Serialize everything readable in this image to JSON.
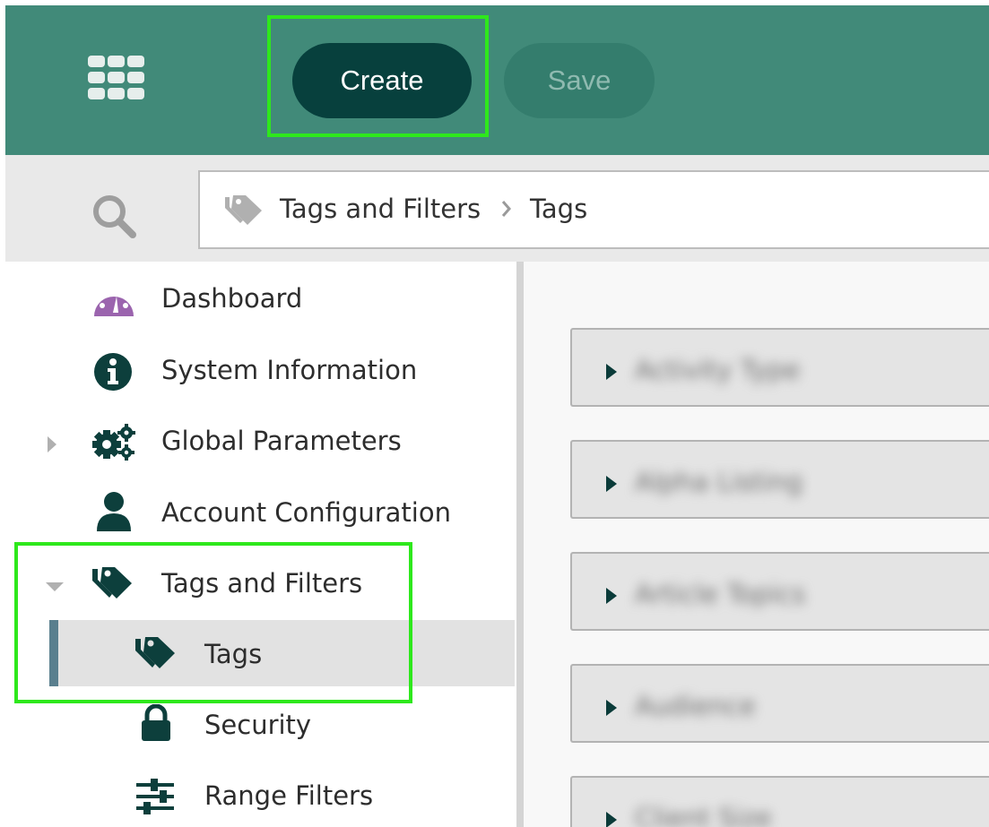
{
  "toolbar": {
    "apps_icon": "grid-apps-icon",
    "create_label": "Create",
    "save_label": "Save",
    "colors": {
      "bar": "#418a79",
      "create_bg": "#07403d",
      "save_bg": "#347d6d",
      "highlight": "#2ee81c"
    }
  },
  "search": {
    "icon": "search-icon"
  },
  "breadcrumb": {
    "icon": "tags-icon",
    "parent": "Tags and Filters",
    "separator_icon": "chevron-right-icon",
    "current": "Tags"
  },
  "sidebar": {
    "items": [
      {
        "label": "Dashboard",
        "icon": "dashboard-gauge-icon",
        "expandable": false
      },
      {
        "label": "System Information",
        "icon": "info-icon",
        "expandable": false
      },
      {
        "label": "Global Parameters",
        "icon": "gears-icon",
        "expandable": true,
        "expanded": false
      },
      {
        "label": "Account Configuration",
        "icon": "user-icon",
        "expandable": false
      },
      {
        "label": "Tags and Filters",
        "icon": "tags-icon",
        "expandable": true,
        "expanded": true,
        "children": [
          {
            "label": "Tags",
            "icon": "tags-icon",
            "selected": true
          },
          {
            "label": "Security",
            "icon": "lock-icon"
          },
          {
            "label": "Range Filters",
            "icon": "sliders-icon"
          }
        ]
      }
    ]
  },
  "main": {
    "accordion_items": [
      {
        "label": "Activity Type"
      },
      {
        "label": "Alpha Listing"
      },
      {
        "label": "Article Topics"
      },
      {
        "label": "Audience"
      },
      {
        "label": "Client Size"
      }
    ]
  }
}
